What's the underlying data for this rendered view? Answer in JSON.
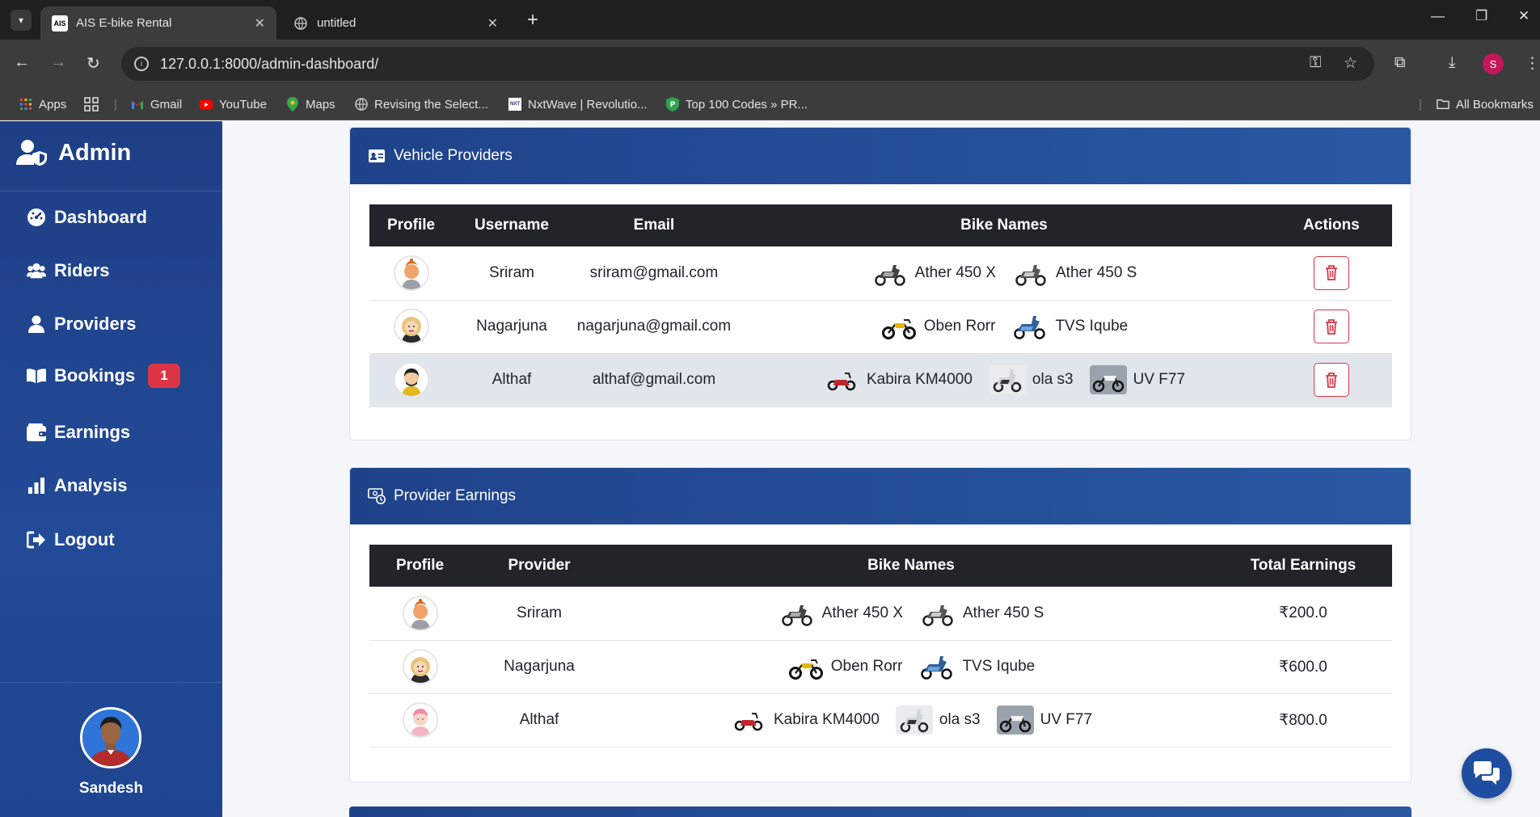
{
  "browser": {
    "tabs": [
      {
        "title": "AIS E-bike Rental",
        "favicon_text": "AIS",
        "active": true
      },
      {
        "title": "untitled",
        "active": false
      }
    ],
    "url": "127.0.0.1:8000/admin-dashboard/",
    "profile_initial": "S",
    "bookmarks": [
      {
        "label": "Apps",
        "icon": "apps-grid-icon"
      },
      {
        "label": "Gmail",
        "icon": "gmail-icon"
      },
      {
        "label": "YouTube",
        "icon": "youtube-icon"
      },
      {
        "label": "Maps",
        "icon": "maps-icon"
      },
      {
        "label": "Revising the Select...",
        "icon": "globe-icon"
      },
      {
        "label": "NxtWave | Revolutio...",
        "icon": "nxtwave-icon"
      },
      {
        "label": "Top 100 Codes » PR...",
        "icon": "shield-icon"
      }
    ],
    "all_bookmarks": "All Bookmarks"
  },
  "sidebar": {
    "brand": "Admin",
    "items": [
      {
        "label": "Dashboard",
        "icon": "gauge-icon"
      },
      {
        "label": "Riders",
        "icon": "users-icon"
      },
      {
        "label": "Providers",
        "icon": "user-icon"
      },
      {
        "label": "Bookings",
        "icon": "book-icon",
        "badge": "1"
      },
      {
        "label": "Earnings",
        "icon": "wallet-icon"
      },
      {
        "label": "Analysis",
        "icon": "bar-chart-icon"
      },
      {
        "label": "Logout",
        "icon": "logout-icon"
      }
    ],
    "user_name": "Sandesh"
  },
  "vehicle_providers": {
    "title": "Vehicle Providers",
    "columns": [
      "Profile",
      "Username",
      "Email",
      "Bike Names",
      "Actions"
    ],
    "rows": [
      {
        "username": "Sriram",
        "email": "sriram@gmail.com",
        "bikes": [
          "Ather 450 X",
          "Ather 450 S"
        ]
      },
      {
        "username": "Nagarjuna",
        "email": "nagarjuna@gmail.com",
        "bikes": [
          "Oben Rorr",
          "TVS Iqube"
        ]
      },
      {
        "username": "Althaf",
        "email": "althaf@gmail.com",
        "bikes": [
          "Kabira KM4000",
          "ola s3",
          "UV F77"
        ]
      }
    ]
  },
  "provider_earnings": {
    "title": "Provider Earnings",
    "columns": [
      "Profile",
      "Provider",
      "Bike Names",
      "Total Earnings"
    ],
    "rows": [
      {
        "provider": "Sriram",
        "bikes": [
          "Ather 450 X",
          "Ather 450 S"
        ],
        "total": "₹200.0"
      },
      {
        "provider": "Nagarjuna",
        "bikes": [
          "Oben Rorr",
          "TVS Iqube"
        ],
        "total": "₹600.0"
      },
      {
        "provider": "Althaf",
        "bikes": [
          "Kabira KM4000",
          "ola s3",
          "UV F77"
        ],
        "total": "₹800.0"
      }
    ]
  },
  "colors": {
    "sidebar": "#1e3f86",
    "card_header": "#1f438a",
    "table_header": "#212529",
    "danger": "#dc3545"
  }
}
